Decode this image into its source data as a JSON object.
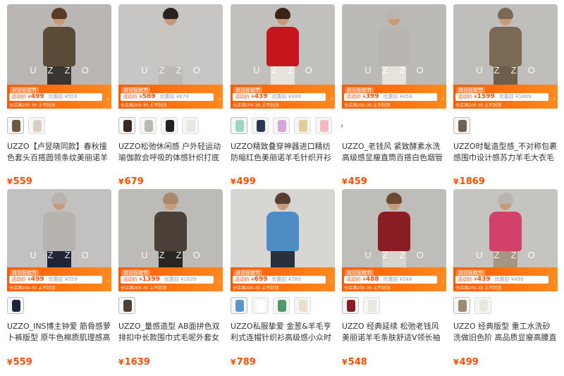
{
  "products": [
    {
      "title": "UZZO【卢昱晓同款】春秋撞色套头百搭圆领条纹美丽诺羊毛针织衫",
      "price": "559",
      "brand_overlay": "UZZO",
      "promo": {
        "tag": "双旦狂欢节",
        "label": "活动价",
        "price": "499",
        "orig_label": "优惠前",
        "orig": "559",
        "sub": "全店满200-30 上不封顶"
      },
      "bg": "#b9b6b4",
      "top_color": "#5a4b37",
      "legs_color": "#3a3533",
      "hair": "#5a3b26",
      "swatches": [
        "#6b5a44",
        "#d8d0c4"
      ]
    },
    {
      "title": "UZZO松弛休闲感 户外轻运动瑜伽款会呼吸的体感针织打底羊毛衫",
      "price": "679",
      "brand_overlay": "UZZO",
      "promo": {
        "tag": "双旦狂欢节",
        "label": "活动价",
        "price": "589",
        "orig_label": "优惠前",
        "orig": "679",
        "sub": "全店满200-30 上不封顶"
      },
      "bg": "#c8c6c4",
      "top_color": "#c9c6c2",
      "legs_color": "#bdbab6",
      "hair": "#2a2220",
      "swatches": [
        "#3a2622",
        "#bbb8b4",
        "#222222",
        "#e8e6e2"
      ]
    },
    {
      "title": "UZZO精致叠穿神器进口精纺防缩红色美丽诺羊毛针织开衫外套女",
      "price": "499",
      "brand_overlay": "UZZO",
      "promo": {
        "tag": "双旦狂欢节",
        "label": "活动价",
        "price": "439",
        "orig_label": "优惠前",
        "orig": "499",
        "sub": "全店满200-30 上不封顶"
      },
      "bg": "#c2c0bd",
      "top_color": "#c4161c",
      "legs_color": "#e8e4dc",
      "hair": "#3a2418",
      "swatches": [
        "#9fd6c4",
        "#2b3650",
        "#d6a6d8",
        "#e0ce98",
        "#f2b8c6"
      ]
    },
    {
      "title": "UZZO_老钱风 紧致酵素水洗 高级感显瘦直筒百搭白色烟管牛仔裤",
      "price": "459",
      "brand_overlay": "UZZO",
      "promo": {
        "tag": "双旦狂欢节",
        "label": "活动价",
        "price": "399",
        "orig_label": "优惠前",
        "orig": "459",
        "sub": "全店满200-30 上不封顶"
      },
      "bg": "#bcbab6",
      "top_color": "#b9b6b2",
      "legs_color": "#e7e3da",
      "hair": "#b9b6b2",
      "swatches": []
    },
    {
      "title": "UZZO时髦造型感_不对称包裹感围巾设计感苏力羊毛大衣毛呢外套",
      "price": "1869",
      "brand_overlay": "UZZO",
      "promo": {
        "tag": "双旦狂欢节",
        "label": "活动价",
        "price": "1599",
        "orig_label": "优惠前",
        "orig": "1869",
        "sub": "全店满200-30 上不封顶"
      },
      "bg": "#c0bebb",
      "top_color": "#7a6a55",
      "legs_color": "#6d5f4c",
      "hair": "#7a6a55",
      "swatches": [
        "#6e6352"
      ]
    },
    {
      "title": "UZZO_INS博主钟爱 筋骨感萝卜裤版型 原牛色棉质肌理感高腰牛仔裤",
      "price": "559",
      "brand_overlay": "UZZO",
      "promo": {
        "tag": "双旦狂欢节",
        "label": "活动价",
        "price": "499",
        "orig_label": "优惠前",
        "orig": "559",
        "sub": "全店满200-30 上不封顶"
      },
      "bg": "#c3c1bf",
      "top_color": "#b7b4b0",
      "legs_color": "#1f2436",
      "hair": "#b7b4b0",
      "swatches": [
        "#1f2436"
      ]
    },
    {
      "title": "UZZO_量感造型 AB面拼色双排扣中长款围巾式毛呢外套女双面呢大衣",
      "price": "1639",
      "brand_overlay": "UZZO",
      "promo": {
        "tag": "双旦狂欢节",
        "label": "活动价",
        "price": "1399",
        "orig_label": "优惠前",
        "orig": "1639",
        "sub": "全店满200-30 上不封顶"
      },
      "bg": "#bdbbb8",
      "top_color": "#4b4038",
      "legs_color": "#2b2522",
      "hair": "#a88a6a",
      "swatches": [
        "#4b4038"
      ]
    },
    {
      "title": "UZZO私服挚爱 金葱&羊毛亨利式连帽针织衫高级感小众时尚连帽开衫",
      "price": "789",
      "brand_overlay": "",
      "promo": {
        "tag": "双旦狂欢节",
        "label": "活动价",
        "price": "699",
        "orig_label": "优惠前",
        "orig": "789",
        "sub": "全店满200-30 上不封顶"
      },
      "bg": "#d8d6d2",
      "top_color": "#4e8cc4",
      "legs_color": "#2a2f3c",
      "hair": "#5a3e2e",
      "swatches": [
        "#5c95c8",
        "#ffffff",
        "#4f9a68",
        "#e8e0cc"
      ]
    },
    {
      "title": "UZZO 经典延续 松弛老钱风美丽诺羊毛条肤舒适V领长袖针织衫女",
      "price": "548",
      "brand_overlay": "UZZO",
      "promo": {
        "tag": "双旦狂欢节",
        "label": "活动价",
        "price": "488",
        "orig_label": "优惠前",
        "orig": "548",
        "sub": "全店满200-30 上不封顶"
      },
      "bg": "#bfbdba",
      "top_color": "#8a1c24",
      "legs_color": "#d9d4cc",
      "hair": "#6e4a30",
      "swatches": [
        "#8a1c24",
        "#e9e6e0"
      ]
    },
    {
      "title": "UZZO 经典版型 重工水洗砂洗做旧色阶 高品质显瘦高腰直筒牛仔裤",
      "price": "499",
      "brand_overlay": "UZZO",
      "promo": {
        "tag": "双旦狂欢节",
        "label": "活动价",
        "price": "439",
        "orig_label": "优惠前",
        "orig": "499",
        "sub": "全店满200-30 上不封顶"
      },
      "bg": "#c6c4c1",
      "top_color": "#d2416a",
      "legs_color": "#a69580",
      "hair": "#b8b5b1",
      "swatches": [
        "#9a8a74",
        "#e9e6e0"
      ]
    }
  ],
  "currency_symbol": "¥",
  "more_arrow": "›",
  "swatch_next": "›"
}
